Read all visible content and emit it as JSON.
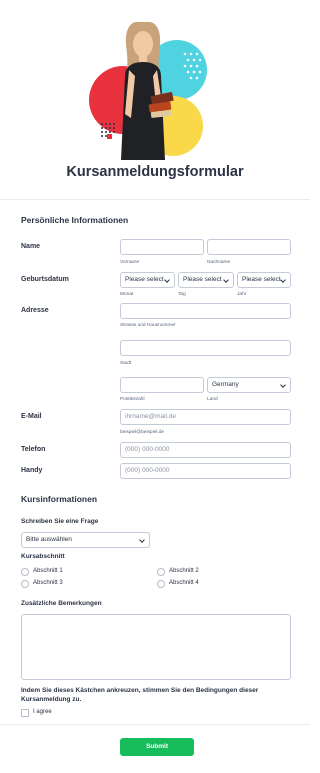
{
  "form": {
    "title": "Kursanmeldungsformular",
    "submit_label": "Submit"
  },
  "personal": {
    "section_title": "Persönliche Informationen",
    "name": {
      "label": "Name",
      "first_sub": "Vorname",
      "last_sub": "Nachname"
    },
    "birthdate": {
      "label": "Geburtsdatum",
      "month_placeholder": "Please select",
      "day_placeholder": "Please select",
      "year_placeholder": "Please select",
      "month_sub": "Monat",
      "day_sub": "Tag",
      "year_sub": "Jahr"
    },
    "address": {
      "label": "Adresse",
      "street_sub": "Strasse und Hausnummer",
      "city_sub": "Stadt",
      "zip_sub": "Postleitzahl",
      "country_value": "Germany",
      "country_sub": "Land"
    },
    "email": {
      "label": "E-Mail",
      "placeholder": "ihrname@mail.de",
      "sub": "beispiel@beispiel.de"
    },
    "phone": {
      "label": "Telefon",
      "placeholder": "(000) 000-0000"
    },
    "mobile": {
      "label": "Handy",
      "placeholder": "(000) 000-0000"
    }
  },
  "course": {
    "section_title": "Kursinformationen",
    "question_label": "Schreiben Sie eine Frage",
    "dropdown_value": "Bitte auswählen",
    "section_label": "Kursabschnitt",
    "options": [
      "Abschnitt 1",
      "Abschnitt 2",
      "Abschnitt 3",
      "Abschnitt 4"
    ],
    "remarks_label": "Zusätzliche Bemerkungen",
    "terms_text": "Indem Sie dieses Kästchen ankreuzen, stimmen Sie den Bedingungen dieser Kursanmeldung zu.",
    "agree_label": "I agree"
  },
  "colors": {
    "accent_green": "#18bd5b",
    "circle_cyan": "#4fd3e0",
    "circle_red": "#e8333f",
    "circle_yellow": "#f9d84a"
  }
}
